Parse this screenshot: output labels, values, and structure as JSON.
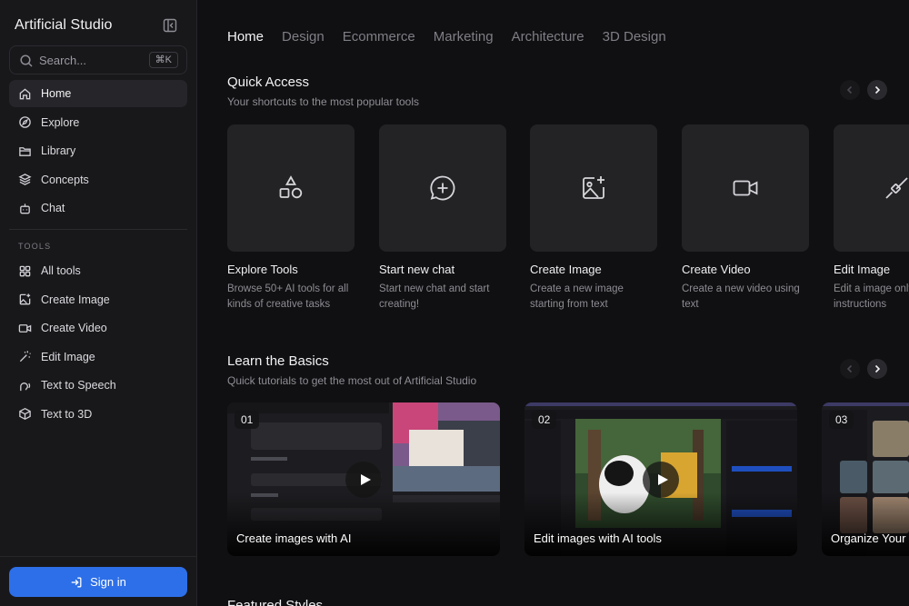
{
  "app": {
    "title": "Artificial Studio"
  },
  "search": {
    "placeholder": "Search...",
    "shortcut": "⌘K"
  },
  "sidebar": {
    "main_items": [
      {
        "label": "Home",
        "icon": "home-icon",
        "active": true
      },
      {
        "label": "Explore",
        "icon": "compass-icon"
      },
      {
        "label": "Library",
        "icon": "folder-icon"
      },
      {
        "label": "Concepts",
        "icon": "layers-icon"
      },
      {
        "label": "Chat",
        "icon": "bot-icon"
      }
    ],
    "tools_heading": "TOOLS",
    "tool_items": [
      {
        "label": "All tools",
        "icon": "grid-icon"
      },
      {
        "label": "Create Image",
        "icon": "image-plus-icon"
      },
      {
        "label": "Create Video",
        "icon": "video-icon"
      },
      {
        "label": "Edit Image",
        "icon": "magic-wand-icon"
      },
      {
        "label": "Text to Speech",
        "icon": "speech-icon"
      },
      {
        "label": "Text to 3D",
        "icon": "cube-icon"
      }
    ],
    "signin_label": "Sign in"
  },
  "tabs": [
    "Home",
    "Design",
    "Ecommerce",
    "Marketing",
    "Architecture",
    "3D Design"
  ],
  "quick_access": {
    "title": "Quick Access",
    "subtitle": "Your shortcuts to the most popular tools",
    "cards": [
      {
        "title": "Explore Tools",
        "desc": "Browse 50+ AI tools for all kinds of creative tasks",
        "icon": "shapes-icon"
      },
      {
        "title": "Start new chat",
        "desc": "Start new chat and start creating!",
        "icon": "chat-plus-icon"
      },
      {
        "title": "Create Image",
        "desc": "Create a new image starting from text",
        "icon": "image-plus-icon"
      },
      {
        "title": "Create Video",
        "desc": "Create a new video using text",
        "icon": "video-icon"
      },
      {
        "title": "Edit Image",
        "desc": "Edit a image only with instructions",
        "icon": "brush-icon"
      }
    ]
  },
  "basics": {
    "title": "Learn the Basics",
    "subtitle": "Quick tutorials to get the most out of Artificial Studio",
    "tutorials": [
      {
        "num": "01",
        "label": "Create images with AI"
      },
      {
        "num": "02",
        "label": "Edit images with AI tools"
      },
      {
        "num": "03",
        "label": "Organize Your Library"
      }
    ]
  },
  "featured": {
    "title": "Featured Styles"
  }
}
